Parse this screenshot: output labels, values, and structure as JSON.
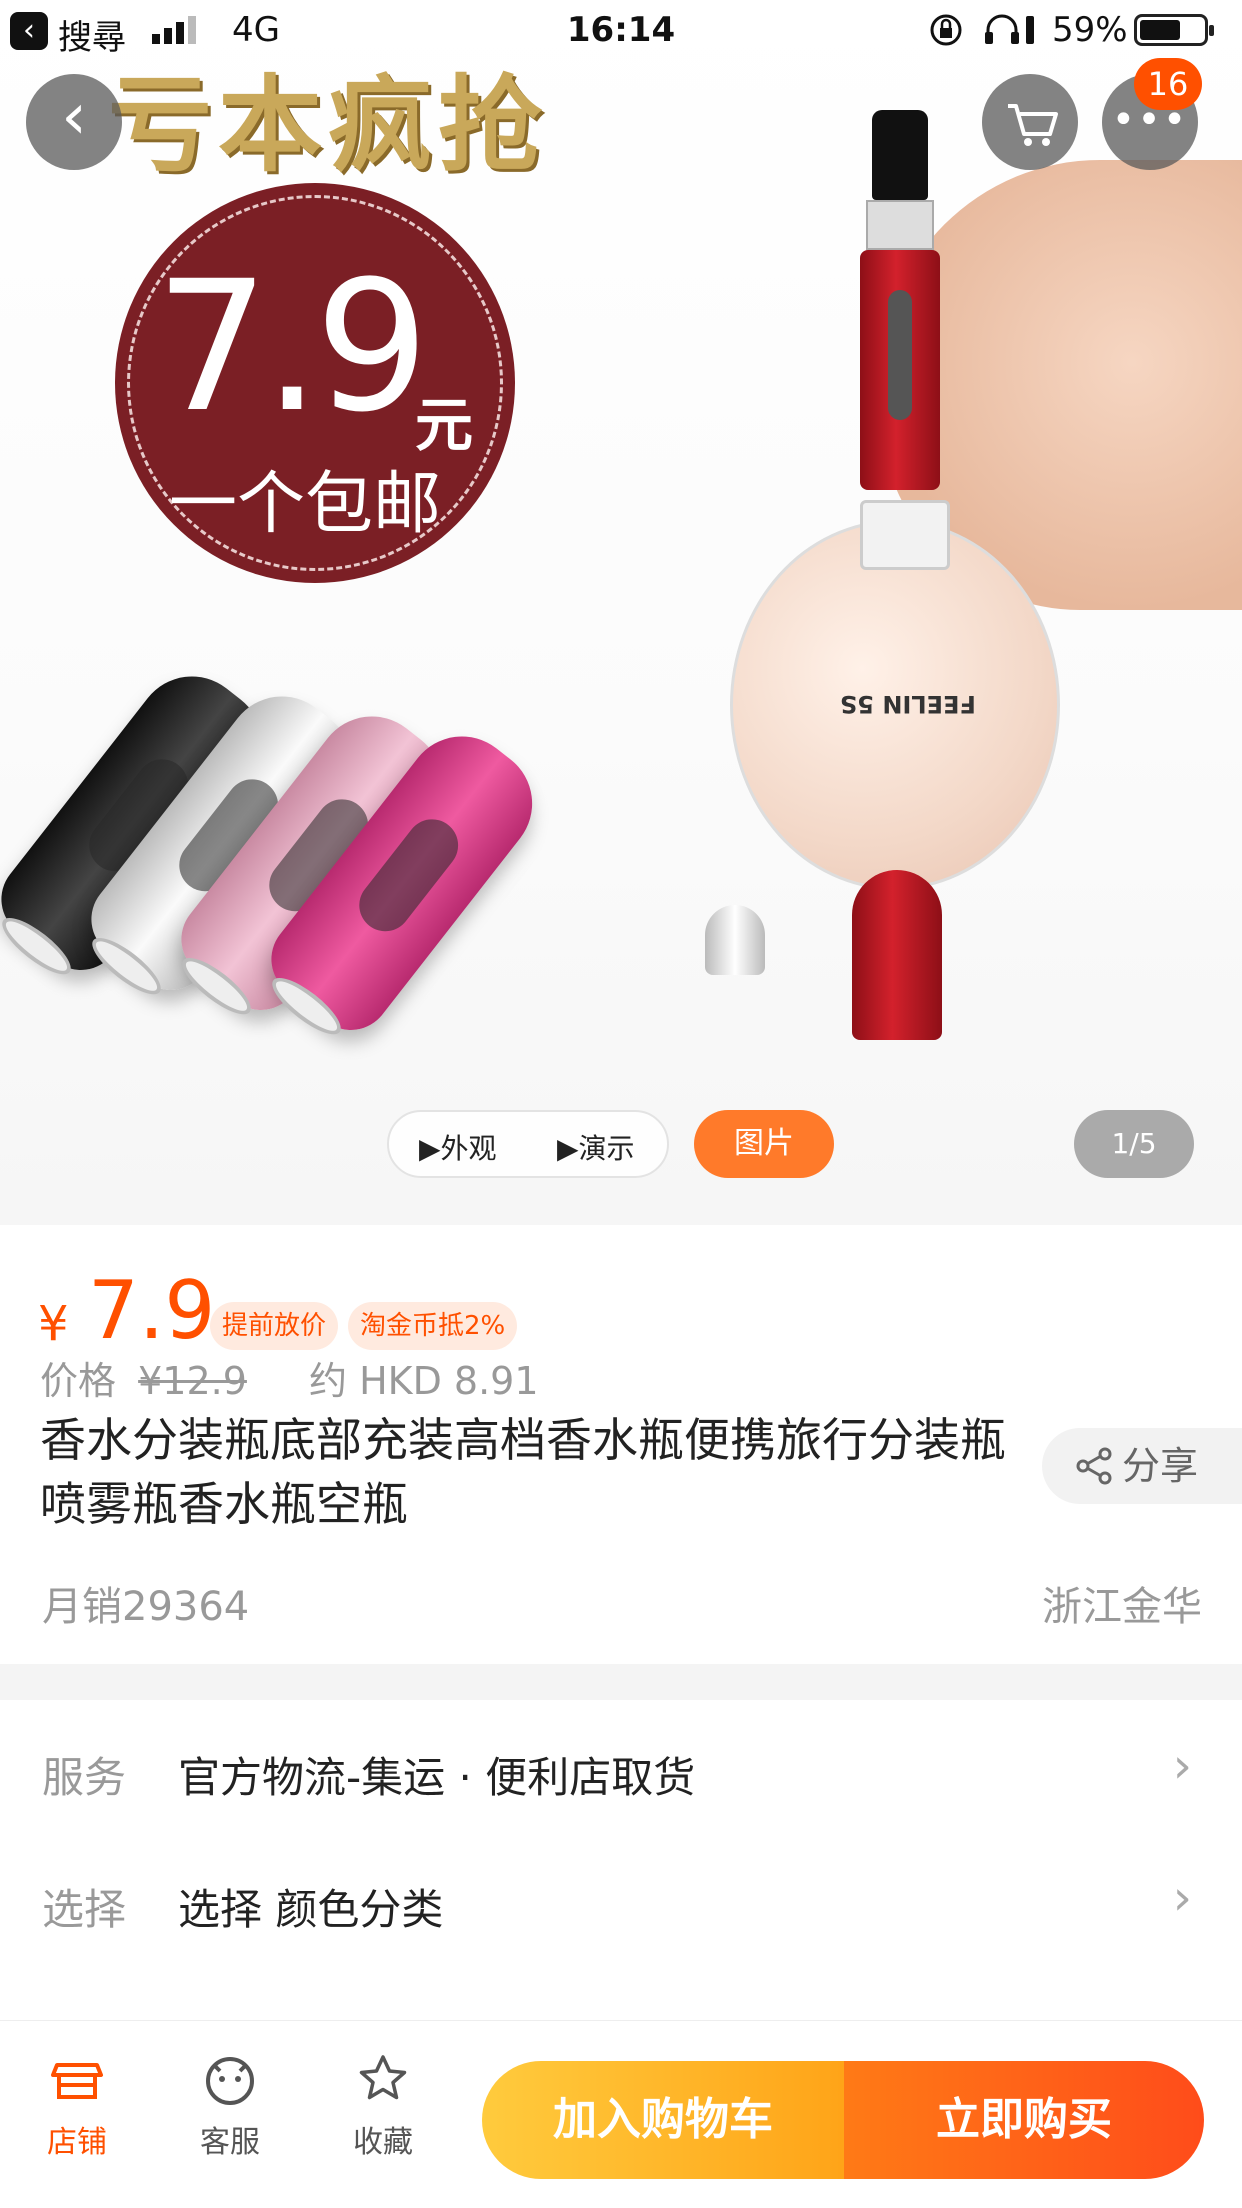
{
  "status_bar": {
    "back_app": "搜尋",
    "network": "4G",
    "time": "16:14",
    "battery_pct": "59%"
  },
  "hero": {
    "promo_banner": "亏本疯抢",
    "badge_price": "7.9",
    "badge_unit": "元",
    "badge_shipping": "一个包邮",
    "product_label": "FEELIN 5S",
    "cart_count": "16",
    "media_tabs": [
      "▶外观",
      "▶演示"
    ],
    "picture_tab": "图片",
    "pager": "1/5"
  },
  "product": {
    "currency": "¥",
    "price": "7.9",
    "tags": [
      "提前放价",
      "淘金币抵2%"
    ],
    "orig_label": "价格",
    "orig_price": "¥12.9",
    "hkd": "约 HKD 8.91",
    "title": "香水分装瓶底部充装高档香水瓶便携旅行分装瓶喷雾瓶香水瓶空瓶",
    "share": "分享",
    "monthly_sales": "月销29364",
    "location": "浙江金华"
  },
  "options": [
    {
      "label": "服务",
      "value": "官方物流-集运 · 便利店取货"
    },
    {
      "label": "选择",
      "value": "选择  颜色分类"
    }
  ],
  "bottom_bar": {
    "store": "店铺",
    "service": "客服",
    "favorite": "收藏",
    "add_to_cart": "加入购物车",
    "buy_now": "立即购买"
  },
  "colors": {
    "accent": "#ff5000",
    "cart_button": "#ffa418",
    "buy_button": "#ff4c1a"
  }
}
